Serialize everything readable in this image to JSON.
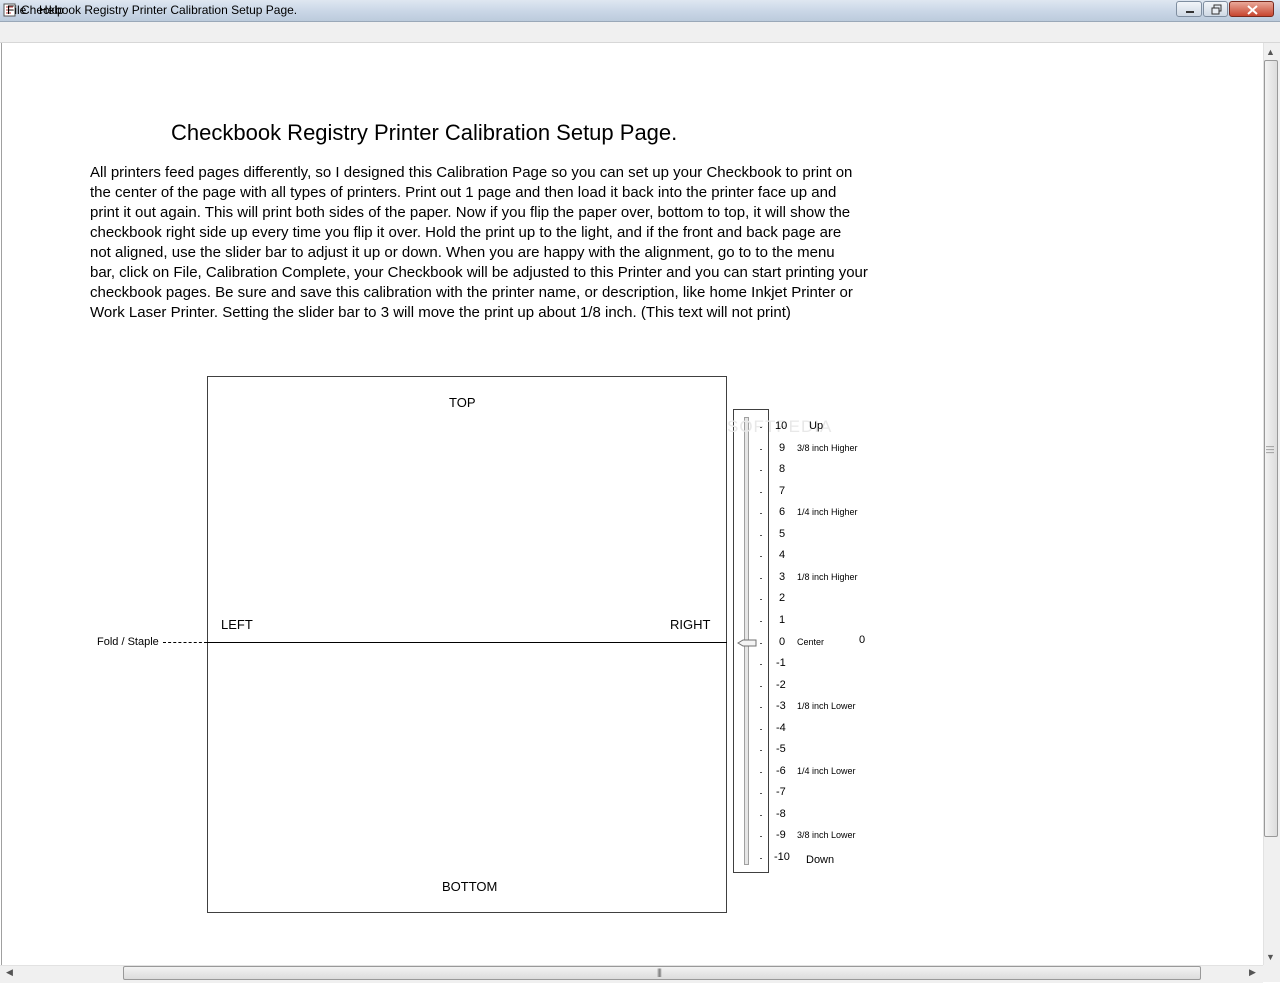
{
  "window": {
    "title": "Checkbook Registry Printer Calibration Setup Page.",
    "icon": "checkbook-app-icon",
    "controls": [
      "minimize-icon",
      "maximize-icon",
      "close-icon"
    ]
  },
  "menu": {
    "file": "File",
    "help": "Help"
  },
  "content": {
    "heading": "Checkbook Registry Printer Calibration Setup Page.",
    "intro_lines": [
      " All printers feed pages differently,  so I designed this Calibration Page so you can set up your Checkbook to print on",
      "the center of the page with all types of printers.  Print out 1 page and then load it back into the printer face up and",
      "print it out again.  This will print both sides of the paper. Now if you flip the paper over, bottom to top, it will show the",
      "checkbook right side up every time you flip it over. Hold the print up to the light,  and if the front and back page are",
      "not aligned,  use the slider bar to adjust it up or down.  When you are happy with the alignment,  go to to the menu",
      "bar, click on File, Calibration Complete, your Checkbook will be adjusted to this Printer and you can start printing your",
      "checkbook pages. Be sure and save this calibration with the printer name, or description, like home Inkjet Printer or",
      "Work Laser Printer. Setting the slider bar to 3 will move the print up about 1/8 inch. (This text will not print)"
    ]
  },
  "paper": {
    "top": "TOP",
    "bottom": "BOTTOM",
    "left": "LEFT",
    "right": "RIGHT",
    "fold": "Fold / Staple"
  },
  "slider": {
    "value": 0,
    "value_label": "0",
    "min": -10,
    "max": 10,
    "up_label": "Up",
    "down_label": "Down",
    "ticks": [
      "10",
      "9",
      "8",
      "7",
      "6",
      "5",
      "4",
      "3",
      "2",
      "1",
      "0",
      "-1",
      "-2",
      "-3",
      "-4",
      "-5",
      "-6",
      "-7",
      "-8",
      "-9",
      "-10"
    ],
    "descriptions": [
      {
        "tick": "9",
        "text": "3/8 inch  Higher"
      },
      {
        "tick": "6",
        "text": "1/4 inch  Higher"
      },
      {
        "tick": "3",
        "text": "1/8 inch  Higher"
      },
      {
        "tick": "0",
        "text": "Center"
      },
      {
        "tick": "-3",
        "text": "1/8 inch  Lower"
      },
      {
        "tick": "-6",
        "text": "1/4 inch  Lower"
      },
      {
        "tick": "-9",
        "text": "3/8 inch  Lower"
      }
    ],
    "watermark": "SOFTPEDIA"
  }
}
